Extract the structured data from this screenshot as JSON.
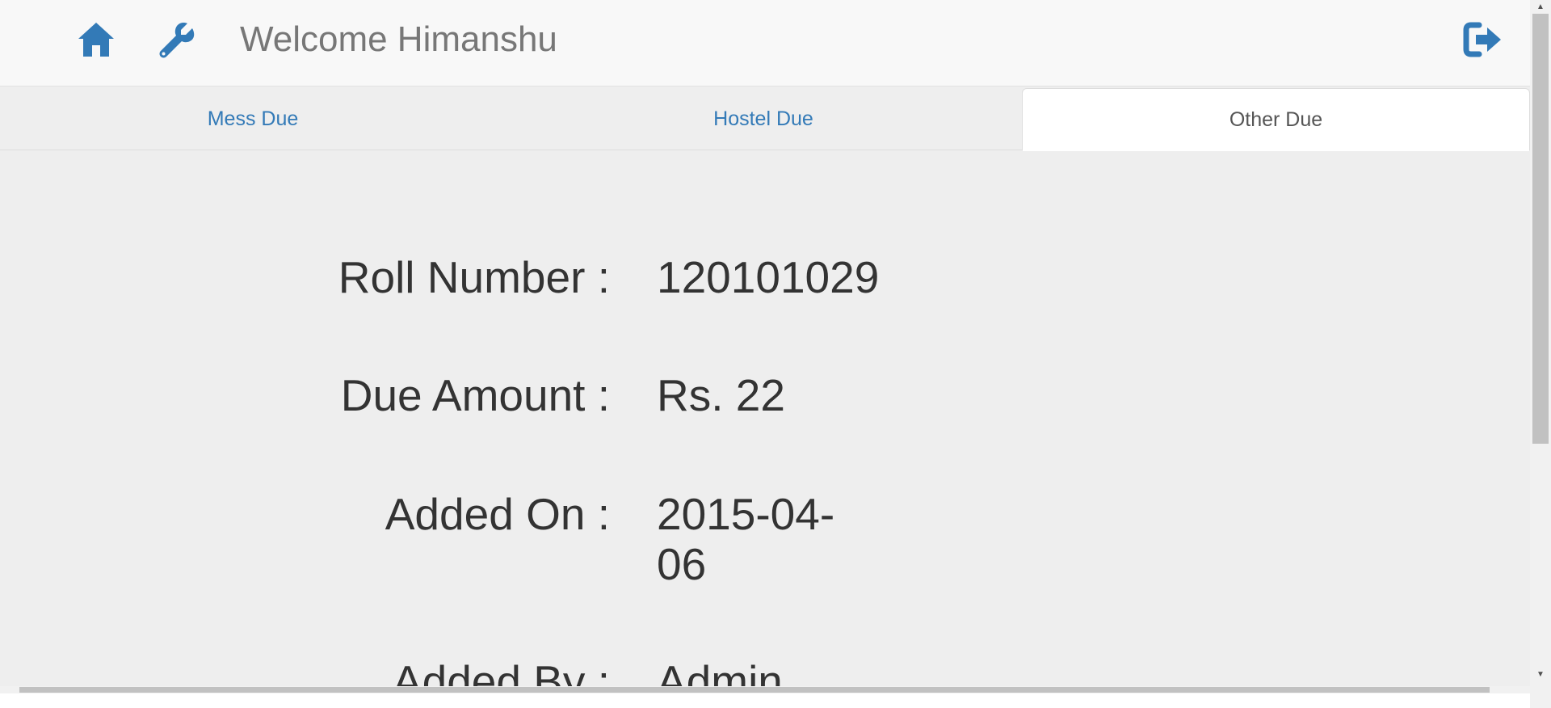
{
  "header": {
    "welcome_text": "Welcome Himanshu",
    "icons": [
      "home-icon",
      "wrench-icon",
      "logout-icon"
    ],
    "accent_color": "#337ab7"
  },
  "tabs": [
    {
      "label": "Mess Due",
      "active": false
    },
    {
      "label": "Hostel Due",
      "active": false
    },
    {
      "label": "Other Due",
      "active": true
    }
  ],
  "details": [
    {
      "label": "Roll Number :",
      "value": "120101029"
    },
    {
      "label": "Due Amount :",
      "value": "Rs. 22"
    },
    {
      "label": "Added On :",
      "value": "2015-04-06"
    },
    {
      "label": "Added By :",
      "value": "Admin"
    }
  ]
}
